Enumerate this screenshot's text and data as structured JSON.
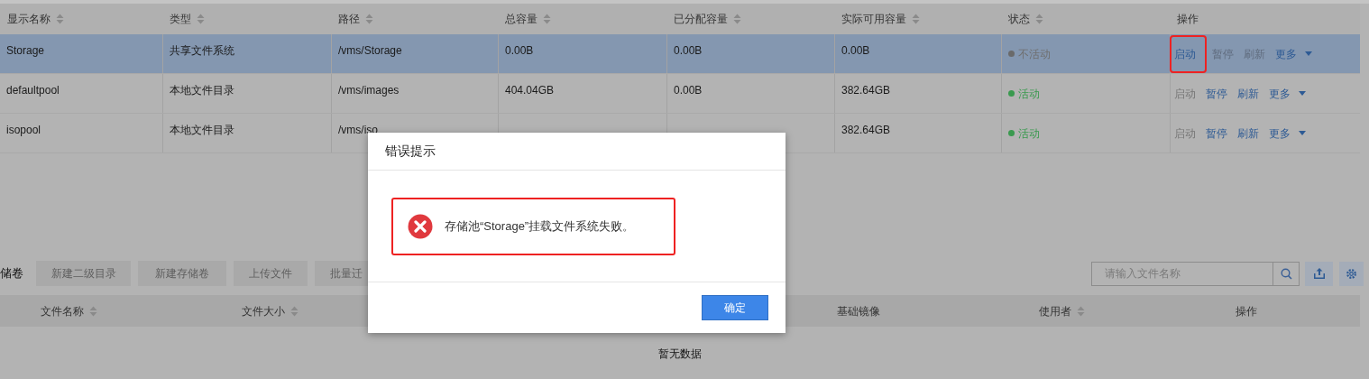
{
  "pool_table": {
    "columns": [
      {
        "label": "显示名称",
        "sortable": true
      },
      {
        "label": "类型",
        "sortable": true
      },
      {
        "label": "路径",
        "sortable": true
      },
      {
        "label": "总容量",
        "sortable": true
      },
      {
        "label": "已分配容量",
        "sortable": true
      },
      {
        "label": "实际可用容量",
        "sortable": true
      },
      {
        "label": "状态",
        "sortable": true
      },
      {
        "label": "操作",
        "sortable": false
      }
    ],
    "rows": [
      {
        "selected": true,
        "cells": [
          "Storage",
          "共享文件系统",
          "/vms/Storage",
          "0.00B",
          "0.00B",
          "0.00B"
        ],
        "status": {
          "label": "不活动",
          "active": false
        },
        "actions": [
          {
            "label": "启动",
            "disabled": false,
            "highlighted": true
          },
          {
            "label": "暂停",
            "disabled": true,
            "highlighted": false
          },
          {
            "label": "刷新",
            "disabled": true,
            "highlighted": false
          },
          {
            "label": "更多",
            "disabled": false,
            "highlighted": false,
            "dropdown": true
          }
        ]
      },
      {
        "selected": false,
        "cells": [
          "defaultpool",
          "本地文件目录",
          "/vms/images",
          "404.04GB",
          "0.00B",
          "382.64GB"
        ],
        "status": {
          "label": "活动",
          "active": true
        },
        "actions": [
          {
            "label": "启动",
            "disabled": true,
            "highlighted": false
          },
          {
            "label": "暂停",
            "disabled": false,
            "highlighted": false
          },
          {
            "label": "刷新",
            "disabled": false,
            "highlighted": false
          },
          {
            "label": "更多",
            "disabled": false,
            "highlighted": false,
            "dropdown": true
          }
        ]
      },
      {
        "selected": false,
        "cells": [
          "isopool",
          "本地文件目录",
          "/vms/iso",
          "",
          "",
          "382.64GB"
        ],
        "status": {
          "label": "活动",
          "active": true
        },
        "actions": [
          {
            "label": "启动",
            "disabled": true,
            "highlighted": false
          },
          {
            "label": "暂停",
            "disabled": false,
            "highlighted": false
          },
          {
            "label": "刷新",
            "disabled": false,
            "highlighted": false
          },
          {
            "label": "更多",
            "disabled": false,
            "highlighted": false,
            "dropdown": true
          }
        ]
      }
    ]
  },
  "volume_panel": {
    "title": "储卷",
    "buttons": [
      {
        "label": "新建二级目录",
        "disabled": true
      },
      {
        "label": "新建存储卷",
        "disabled": true
      },
      {
        "label": "上传文件",
        "disabled": true
      },
      {
        "label": "批量迁",
        "disabled": true
      }
    ],
    "search": {
      "placeholder": "请输入文件名称"
    },
    "columns": [
      {
        "label": "文件名称",
        "sortable": true
      },
      {
        "label": "文件大小",
        "sortable": true
      },
      {
        "label": "基础镜像",
        "sortable": false
      },
      {
        "label": "使用者",
        "sortable": true
      },
      {
        "label": "操作",
        "sortable": false
      }
    ],
    "empty_text": "暂无数据"
  },
  "dialog": {
    "title": "错误提示",
    "message": "存储池“Storage”挂载文件系统失败。",
    "highlighted": true,
    "button": "确定"
  }
}
